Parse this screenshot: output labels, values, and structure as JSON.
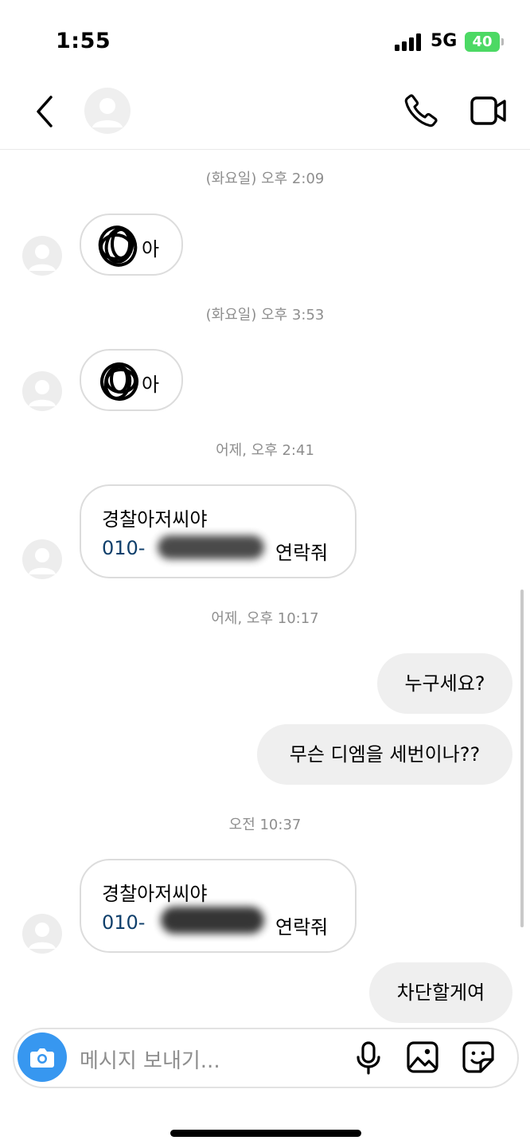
{
  "status_bar": {
    "time": "1:55",
    "network": "5G",
    "battery": "40"
  },
  "header": {
    "contact_name": ""
  },
  "timestamps": [
    "(화요일) 오후 2:09",
    "(화요일) 오후 3:53",
    "어제, 오후 2:41",
    "어제, 오후 10:17",
    "오전 10:37"
  ],
  "messages": {
    "m1_suffix": "아",
    "m2_suffix": "아",
    "m3_line1": "경찰아저씨야",
    "m3_phone_prefix": "010-",
    "m3_suffix": "연락줘",
    "m4": "누구세요?",
    "m5": "무슨 디엠을 세번이나??",
    "m6_line1": "경찰아저씨야",
    "m6_phone_prefix": "010-",
    "m6_suffix": "연락줘",
    "m7": "차단할게여"
  },
  "composer": {
    "placeholder": "메시지 보내기..."
  },
  "colors": {
    "accent": "#3797f0",
    "battery": "#4cd964",
    "link": "#0f3f6b"
  }
}
